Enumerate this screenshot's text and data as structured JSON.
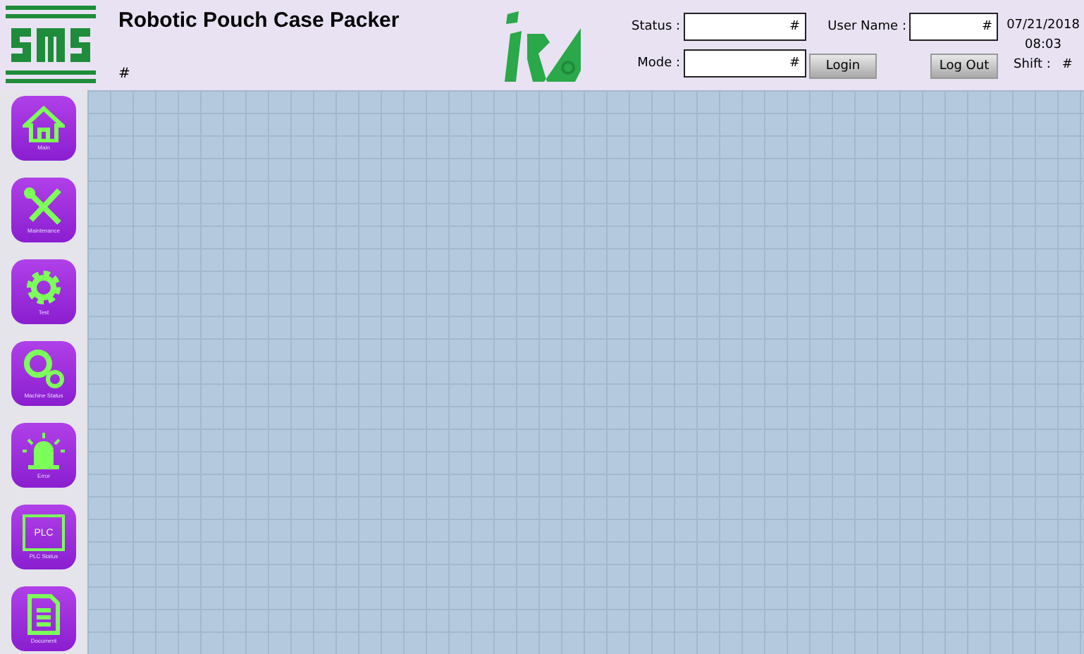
{
  "header": {
    "title": "Robotic Pouch Case Packer",
    "subtitle": "#",
    "fields": [
      {
        "label": "Status :",
        "value": "#"
      },
      {
        "label": "Mode :",
        "value": "#"
      }
    ],
    "user": {
      "label": "User Name :",
      "value": "#"
    },
    "buttons": [
      "Login",
      "Log Out"
    ],
    "date": "07/21/2018",
    "time": "08:03",
    "shift_label": "Shift :",
    "shift_value": "#"
  },
  "sidebar": {
    "items": [
      {
        "kind": "home",
        "label": "Main"
      },
      {
        "kind": "tools",
        "label": "Maintenance"
      },
      {
        "kind": "gear",
        "label": "Test"
      },
      {
        "kind": "gears",
        "label": "Machine Status"
      },
      {
        "kind": "alarm",
        "label": "Error"
      },
      {
        "kind": "chip",
        "label": "PLC Status",
        "chip_text": "PLC"
      },
      {
        "kind": "doc",
        "label": "Document"
      }
    ]
  }
}
